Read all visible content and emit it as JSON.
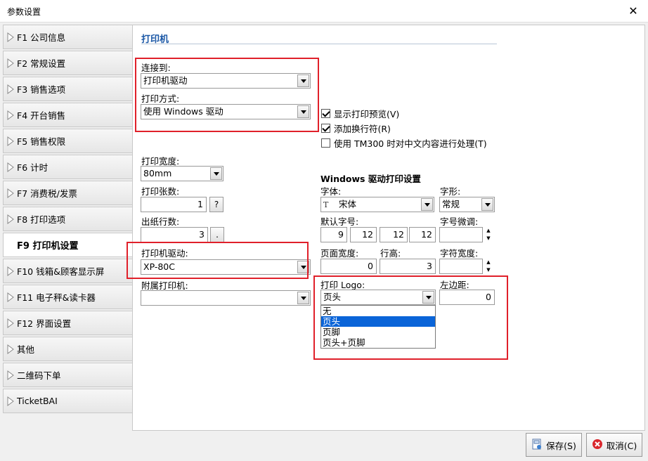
{
  "window": {
    "title": "参数设置",
    "close": "✕"
  },
  "sidebar": {
    "items": [
      {
        "label": "F1 公司信息"
      },
      {
        "label": "F2 常规设置"
      },
      {
        "label": "F3 销售选项"
      },
      {
        "label": "F4 开台销售"
      },
      {
        "label": "F5 销售权限"
      },
      {
        "label": "F6 计时"
      },
      {
        "label": "F7 消费税/发票"
      },
      {
        "label": "F8 打印选项"
      },
      {
        "label": "F9 打印机设置"
      },
      {
        "label": "F10 钱箱&顾客显示屏"
      },
      {
        "label": "F11 电子秤&读卡器"
      },
      {
        "label": "F12 界面设置"
      },
      {
        "label": "其他"
      },
      {
        "label": "二维码下单"
      },
      {
        "label": "TicketBAI"
      }
    ]
  },
  "panel": {
    "title": "打印机",
    "connect_label": "连接到:",
    "connect_value": "打印机驱动",
    "mode_label": "打印方式:",
    "mode_value": "使用 Windows 驱动",
    "width_label": "打印宽度:",
    "width_value": "80mm",
    "copies_label": "打印张数:",
    "copies_value": "1",
    "copies_help": "?",
    "feed_label": "出纸行数:",
    "feed_value": "3",
    "feed_btn": ".",
    "driver_label": "打印机驱动:",
    "driver_value": "XP-80C",
    "aux_label": "附属打印机:",
    "aux_value": "",
    "options": {
      "preview": "显示打印预览(V)",
      "newline": "添加换行符(R)",
      "tm300": "使用 TM300 时对中文内容进行处理(T)"
    },
    "win": {
      "title": "Windows 驱动打印设置",
      "font_label": "字体:",
      "font_value": "宋体",
      "style_label": "字形:",
      "style_value": "常规",
      "default_size_label": "默认字号:",
      "sizes": [
        "9",
        "12",
        "12",
        "12"
      ],
      "size_adjust_label": "字号微调:",
      "page_width_label": "页面宽度:",
      "page_width_value": "0",
      "line_height_label": "行高:",
      "line_height_value": "3",
      "char_width_label": "字符宽度:",
      "logo_label": "打印 Logo:",
      "logo_value": "页头",
      "margin_label": "左边距:",
      "margin_value": "0",
      "logo_options": [
        "无",
        "页头",
        "页脚",
        "页头+页脚"
      ]
    }
  },
  "footer": {
    "save": "保存(S)",
    "cancel": "取消(C)"
  },
  "colors": {
    "accent": "#1a57a6",
    "highlight": "#e0202a",
    "selection": "#0a64d8"
  }
}
